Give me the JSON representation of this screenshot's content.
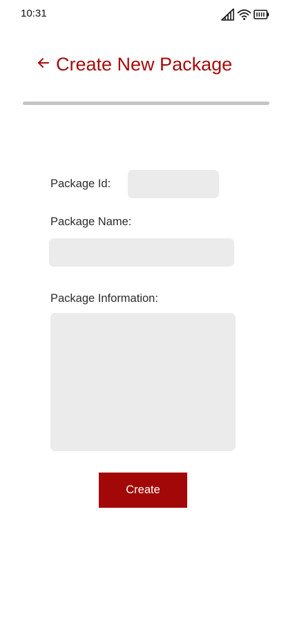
{
  "status_bar": {
    "time": "10:31",
    "icons": [
      "signal-icon",
      "wifi-icon",
      "battery-icon"
    ]
  },
  "header": {
    "back_icon": "arrow-left-icon",
    "title": "Create New Package"
  },
  "form": {
    "package_id": {
      "label": "Package Id:",
      "value": "",
      "placeholder": ""
    },
    "package_name": {
      "label": "Package Name:",
      "value": "",
      "placeholder": ""
    },
    "package_information": {
      "label": "Package Information:",
      "value": "",
      "placeholder": ""
    },
    "create_label": "Create"
  },
  "colors": {
    "accent": "#a30c0c",
    "button": "#a30808",
    "field_background": "#ebebeb",
    "divider": "#c4c4c4"
  }
}
